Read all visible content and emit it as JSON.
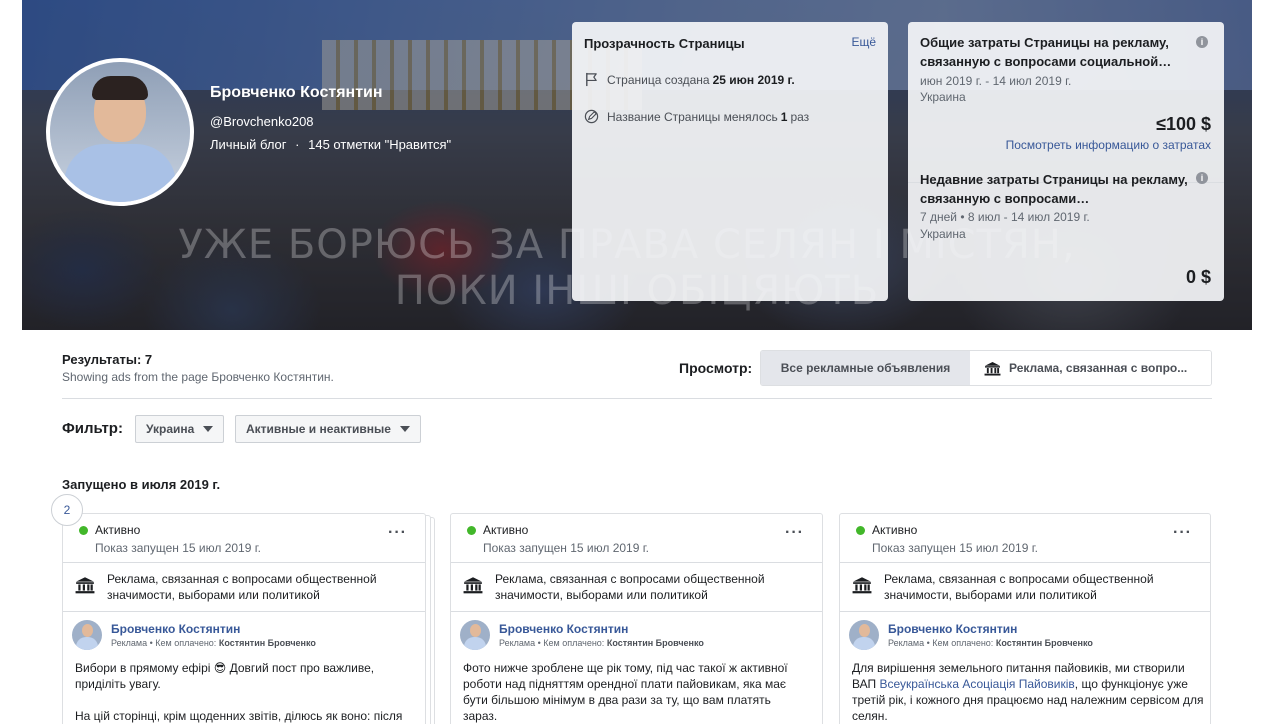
{
  "cover": {
    "slogan_line1": "УЖЕ БОРЮСЬ ЗА ПРАВА СЕЛЯН І МІСТЯН,",
    "slogan_line2": "ПОКИ ІНШІ ОБІЦЯЮТЬ"
  },
  "page": {
    "name": "Бровченко Костянтин",
    "handle": "@Brovchenko208",
    "category": "Личный блог",
    "likes": "145 отметки \"Нравится\"",
    "separator": "·"
  },
  "transparency": {
    "title": "Прозрачность Страницы",
    "more_label": "Ещё",
    "created_prefix": "Страница создана",
    "created_date": "25 июн 2019 г.",
    "name_changed_prefix": "Название Страницы менялось",
    "name_changed_count": "1",
    "name_changed_suffix": "раз"
  },
  "spend": {
    "total_title": "Общие затраты Страницы на рекламу, связанную с вопросами социальной…",
    "total_period": "июн 2019 г. - 14 июл 2019 г.",
    "total_region": "Украина",
    "total_amount": "≤100 $",
    "total_link": "Посмотреть информацию о затратах",
    "recent_title": "Недавние затраты Страницы на рекламу, связанную с вопросами…",
    "recent_period": "7 дней • 8 июл - 14 июл 2019 г.",
    "recent_region": "Украина",
    "recent_amount": "0 $",
    "info_glyph": "i"
  },
  "results": {
    "count_label": "Результаты: 7",
    "subtitle": "Showing ads from the page Бровченко Костянтин.",
    "view_label": "Просмотр:",
    "view_all": "Все рекламные объявления",
    "view_political": "Реклама, связанная с вопро..."
  },
  "filters": {
    "label": "Фильтр:",
    "country": "Украина",
    "status": "Активные и неактивные"
  },
  "group": {
    "launched_label": "Запущено в июля 2019 г.",
    "stack_count": "2"
  },
  "ads": [
    {
      "status": "Активно",
      "started": "Показ запущен 15 июл 2019 г.",
      "category": "Реклама, связанная с вопросами общественной значимости, выборами или политикой",
      "page_name": "Бровченко Костянтин",
      "paid_prefix": "Реклама • Кем оплачено:",
      "paid_by": "Костянтин Бровченко",
      "text_line1": "Вибори в прямому ефірі 😎 Довгий пост про важливе, приділіть увагу.",
      "text_line2": "На цій сторінці, крім щоденних звітів, ділюсь як воно: після"
    },
    {
      "status": "Активно",
      "started": "Показ запущен 15 июл 2019 г.",
      "category": "Реклама, связанная с вопросами общественной значимости, выборами или политикой",
      "page_name": "Бровченко Костянтин",
      "paid_prefix": "Реклама • Кем оплачено:",
      "paid_by": "Костянтин Бровченко",
      "text_line1": "Фото нижче зроблене ще рік тому, під час такої ж активної роботи над підняттям орендної плати пайовикам, яка має бути більшою мінімум в два рази за ту, що вам платять зараз."
    },
    {
      "status": "Активно",
      "started": "Показ запущен 15 июл 2019 г.",
      "category": "Реклама, связанная с вопросами общественной значимости, выборами или политикой",
      "page_name": "Бровченко Костянтин",
      "paid_prefix": "Реклама • Кем оплачено:",
      "paid_by": "Костянтин Бровченко",
      "text_pre": "Для вирішення земельного питання пайовиків, ми створили ВАП",
      "text_link": "Всеукраїнська Асоціація Пайовиків",
      "text_post": ", що функціонує уже третій рік, і кожного дня працюємо над належним сервісом для селян."
    }
  ],
  "icons": {
    "flag": "flag-icon",
    "edit": "edit-icon",
    "building": "government-building-icon",
    "more": "more-horizontal-icon",
    "caret": "caret-down-icon"
  },
  "colors": {
    "link": "#385898",
    "active_dot": "#42b72a",
    "text": "#1c1e21",
    "muted": "#606770"
  }
}
